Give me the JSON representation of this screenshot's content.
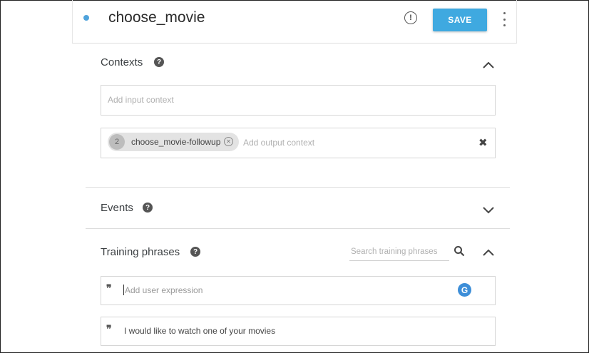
{
  "intent": {
    "title": "choose_movie"
  },
  "toolbar": {
    "save_label": "SAVE",
    "status_icon": "alert-circle-icon",
    "more_icon": "more-vert-icon"
  },
  "contexts": {
    "title": "Contexts",
    "help_icon": "help-icon",
    "expanded": true,
    "input_placeholder": "Add input context",
    "output_contexts": [
      {
        "lifespan": "2",
        "name": "choose_movie-followup"
      }
    ],
    "output_placeholder": "Add output context"
  },
  "events": {
    "title": "Events",
    "expanded": false
  },
  "training_phrases": {
    "title": "Training phrases",
    "expanded": true,
    "search_placeholder": "Search training phrases",
    "input_placeholder": "Add user expression",
    "phrases": [
      "I would like to watch one of your movies"
    ]
  },
  "colors": {
    "accent": "#3fa9e0",
    "status_dot": "#4fa3dc",
    "grammarly": "#3d8ed8"
  }
}
